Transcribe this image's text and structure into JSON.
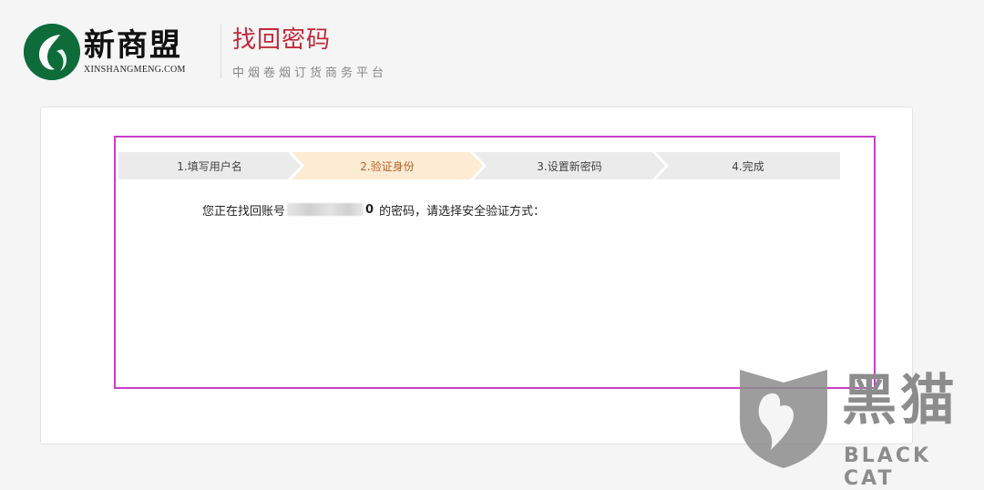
{
  "header": {
    "brand_name": "新商盟",
    "brand_domain": "XINSHANGMENG.COM",
    "title": "找回密码",
    "subtitle": "中烟卷烟订货商务平台"
  },
  "steps": [
    {
      "label": "1.填写用户名",
      "state": "done"
    },
    {
      "label": "2.验证身份",
      "state": "active"
    },
    {
      "label": "3.设置新密码",
      "state": "pending"
    },
    {
      "label": "4.完成",
      "state": "pending"
    }
  ],
  "colors": {
    "brand_green": "#0e6b3a",
    "title_red": "#c2293a",
    "active_step_bg": "#fdebd3",
    "inactive_step_bg": "#ebebeb",
    "highlight_border": "#c73fc7"
  },
  "content": {
    "prefix": "您正在找回账号",
    "masked_account_tail": "0",
    "suffix": "的密码，请选择安全验证方式："
  },
  "watermark": {
    "cn": "黑猫",
    "en": "BLACK CAT"
  }
}
